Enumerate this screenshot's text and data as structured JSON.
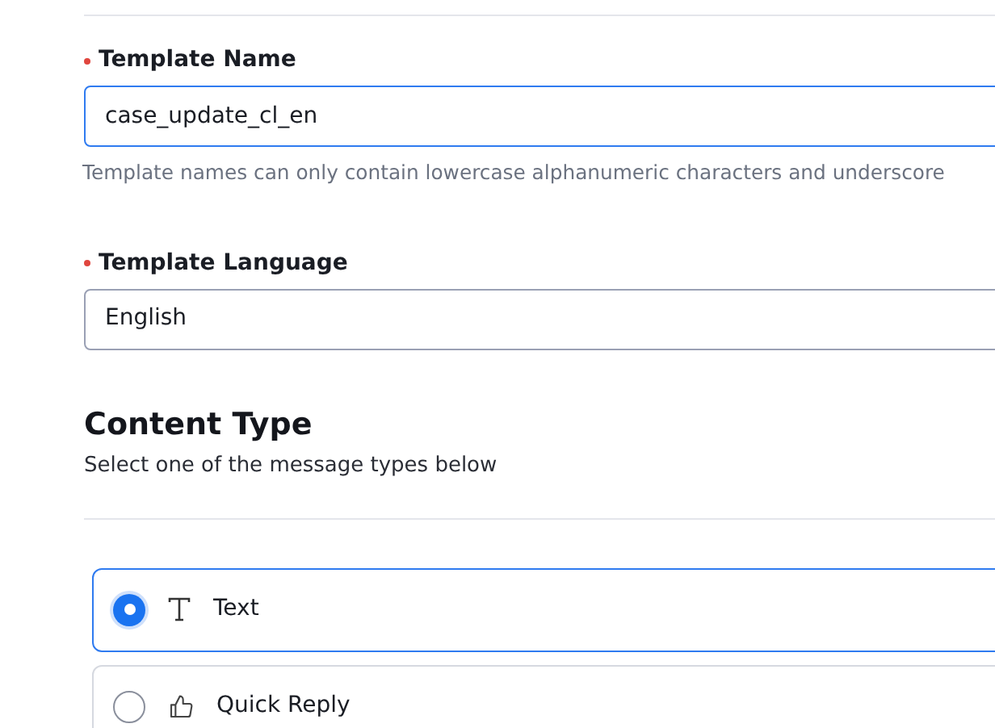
{
  "template_name": {
    "label": "Template Name",
    "required": true,
    "value": "case_update_cl_en",
    "hint": "Template names can only contain lowercase alphanumeric characters and underscore"
  },
  "template_language": {
    "label": "Template Language",
    "required": true,
    "value": "English"
  },
  "content_type": {
    "title": "Content Type",
    "subtitle": "Select one of the message types below",
    "options": [
      {
        "kind": "text",
        "label": "Text",
        "selected": true
      },
      {
        "kind": "quick_reply",
        "label": "Quick Reply",
        "selected": false
      }
    ]
  }
}
